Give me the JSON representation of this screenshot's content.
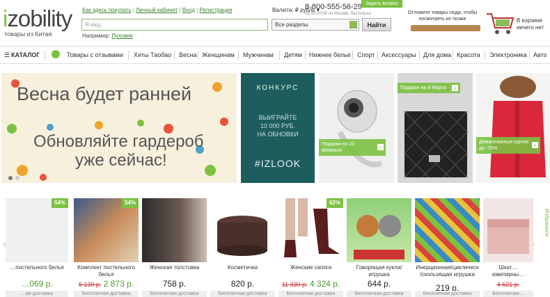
{
  "header": {
    "logo_i": "i",
    "logo_rest": "zobility",
    "tagline": "товары из Китая",
    "links": [
      "Как здесь покупать",
      "Личный кабинет",
      "Вход",
      "Регистрация"
    ],
    "search_placeholder": "Я ищу...",
    "example_label": "Например:",
    "example_link": "Пуховик",
    "currency_label": "Валюта:",
    "currency_value": "₽ рубль",
    "phone": "8-800-555-56-29",
    "hours": "08:00-20:00 по Москве, бесплатно",
    "ask_button": "Задать вопрос",
    "sections_select": "Все разделы",
    "find_button": "Найти",
    "postpone_text": "Отложите товары сюда, чтобы посмотреть их позже",
    "cart_line1": "В корзине",
    "cart_line2": "ничего нет"
  },
  "nav": {
    "catalog": "КАТАЛОГ",
    "items": [
      "Товары с отзывами",
      "Хиты Таобао",
      "Весна",
      "Женщинам",
      "Мужчинам",
      "Детям",
      "Нижнее белье",
      "Спорт",
      "Аксессуары",
      "Для дома",
      "Красота",
      "Электроника",
      "Авто"
    ]
  },
  "banners": {
    "main_line1": "Весна будет ранней",
    "main_line2": "Обновляйте гардероб",
    "main_line3": "уже сейчас!",
    "contest_title": "КОНКУРС",
    "contest_line1": "ВЫИГРАЙТЕ",
    "contest_line2": "10 000 РУБ.",
    "contest_line3": "НА ОБНОВКИ",
    "contest_tag": "#IZLOOK",
    "tag3": "Подарки на 23 февраля",
    "tag4": "Подарки на 8 Марта",
    "tag5": "Демисезонные куртки: до -70%"
  },
  "products": [
    {
      "name": "…постельного белья",
      "old": "",
      "price": "…069 р.",
      "badge": "54%",
      "delivery": "…ая доставка"
    },
    {
      "name": "Комплект постельного белья",
      "old": "6 139 р.",
      "price": "2 873 р.",
      "badge": "54%",
      "delivery": "Бесплатная доставка"
    },
    {
      "name": "Женская толстовка",
      "old": "",
      "price": "758 р.",
      "badge": "",
      "delivery": "Бесплатная доставка"
    },
    {
      "name": "Косметичка",
      "old": "",
      "price": "820 р.",
      "badge": "",
      "delivery": "Бесплатная доставка"
    },
    {
      "name": "Женские сапоги",
      "old": "11 330 р.",
      "price": "4 324 р.",
      "badge": "62%",
      "delivery": "Бесплатная доставка"
    },
    {
      "name": "Говорящая кукла/игрушка",
      "old": "",
      "price": "644 р.",
      "badge": "",
      "delivery": "Бесплатная доставка"
    },
    {
      "name": "Инерционная/циклическ /скользящая игрушка",
      "old": "",
      "price": "219 р.",
      "badge": "",
      "delivery": "Бесплатная доставка"
    },
    {
      "name": "Шкат… ювелирны…",
      "old": "4 621 р.",
      "price": "",
      "badge": "",
      "delivery": "Бесплатная…"
    }
  ],
  "favorites_tab": "Избранное",
  "colors": {
    "accent": "#7cc142",
    "link": "#3a7d2a",
    "oldprice": "#cc3333"
  }
}
